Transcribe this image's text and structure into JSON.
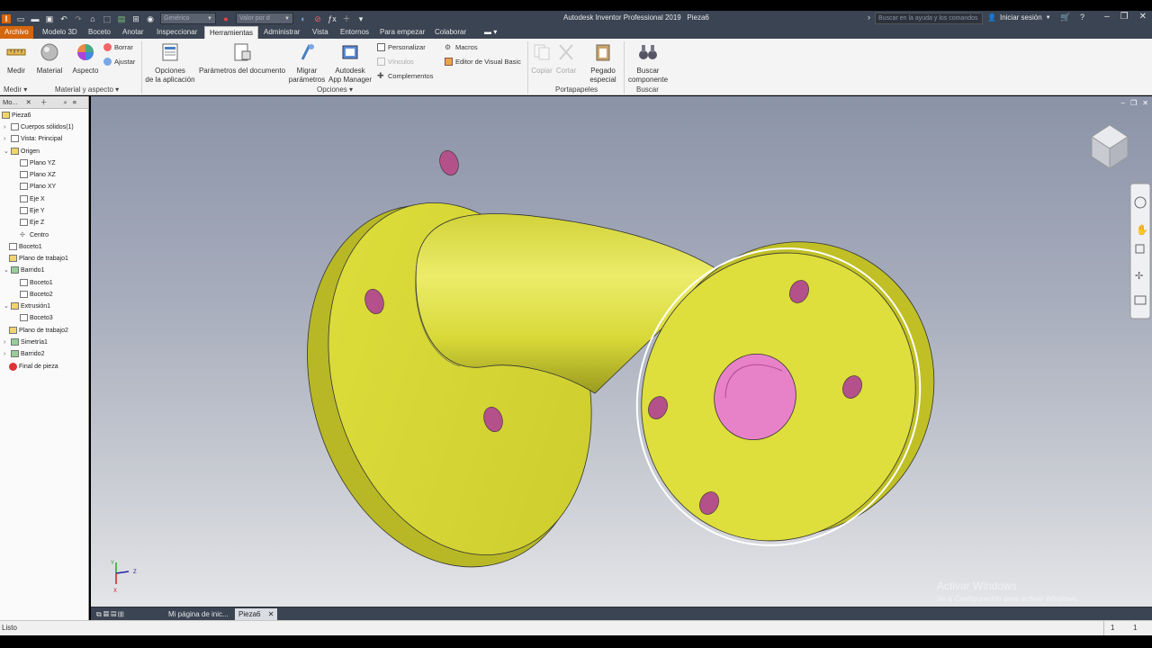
{
  "app": {
    "title": "Autodesk Inventor Professional 2019",
    "document": "Pieza6"
  },
  "qat": {
    "material_combo": "Genérico",
    "appearance_combo": "Valor por d"
  },
  "help": {
    "search_placeholder": "Buscar en la ayuda y los comandos",
    "signin_label": "Iniciar sesión"
  },
  "tabs": [
    {
      "label": "Archivo"
    },
    {
      "label": "Modelo 3D"
    },
    {
      "label": "Boceto"
    },
    {
      "label": "Anotar"
    },
    {
      "label": "Inspeccionar"
    },
    {
      "label": "Herramientas"
    },
    {
      "label": "Administrar"
    },
    {
      "label": "Vista"
    },
    {
      "label": "Entornos"
    },
    {
      "label": "Para empezar"
    },
    {
      "label": "Colaborar"
    }
  ],
  "ribbon": {
    "medir": "Medir",
    "material": "Material",
    "aspecto": "Aspecto",
    "borrar": "Borrar",
    "ajustar": "Ajustar",
    "opciones_aplicacion_1": "Opciones",
    "opciones_aplicacion_2": "de la aplicación",
    "parametros_documento": "Parámetros del documento",
    "migrar_1": "Migrar",
    "migrar_2": "parámetros",
    "app_manager_1": "Autodesk",
    "app_manager_2": "App Manager",
    "personalizar": "Personalizar",
    "vinculos": "Vínculos",
    "complementos": "Complementos",
    "macros": "Macros",
    "editor_vb": "Editor de Visual Basic",
    "copiar": "Copiar",
    "cortar": "Cortar",
    "pegado_1": "Pegado",
    "pegado_2": "especial",
    "buscar_1": "Buscar",
    "buscar_2": "componente",
    "panels": {
      "medir": "Medir",
      "material_aspecto": "Material y aspecto",
      "opciones": "Opciones",
      "portapapeles": "Portapapeles",
      "buscar": "Buscar"
    }
  },
  "browser": {
    "tab_label": "Mo...",
    "nodes": [
      {
        "label": "Pieza6"
      },
      {
        "label": "Cuerpos sólidos(1)"
      },
      {
        "label": "Vista: Principal"
      },
      {
        "label": "Origen"
      },
      {
        "label": "Plano YZ"
      },
      {
        "label": "Plano XZ"
      },
      {
        "label": "Plano XY"
      },
      {
        "label": "Eje X"
      },
      {
        "label": "Eje Y"
      },
      {
        "label": "Eje Z"
      },
      {
        "label": "Centro"
      },
      {
        "label": "Boceto1"
      },
      {
        "label": "Plano de trabajo1"
      },
      {
        "label": "Barrido1"
      },
      {
        "label": "Boceto1"
      },
      {
        "label": "Boceto2"
      },
      {
        "label": "Extrusión1"
      },
      {
        "label": "Boceto3"
      },
      {
        "label": "Plano de trabajo2"
      },
      {
        "label": "Simetría1"
      },
      {
        "label": "Barrido2"
      },
      {
        "label": "Final de pieza"
      }
    ]
  },
  "doctabs": {
    "home": "Mi página de inic...",
    "part": "Pieza6"
  },
  "status": {
    "text": "Listo",
    "num1": "1",
    "num2": "1"
  },
  "watermark": {
    "line1": "Activar Windows",
    "line2": "Ve a Configuración para activar Windows."
  },
  "colors": {
    "part_yellow": "#e2e23a",
    "hole_pink": "#e882c8",
    "file_tab": "#d4660e",
    "titlebar": "#3b4453"
  }
}
